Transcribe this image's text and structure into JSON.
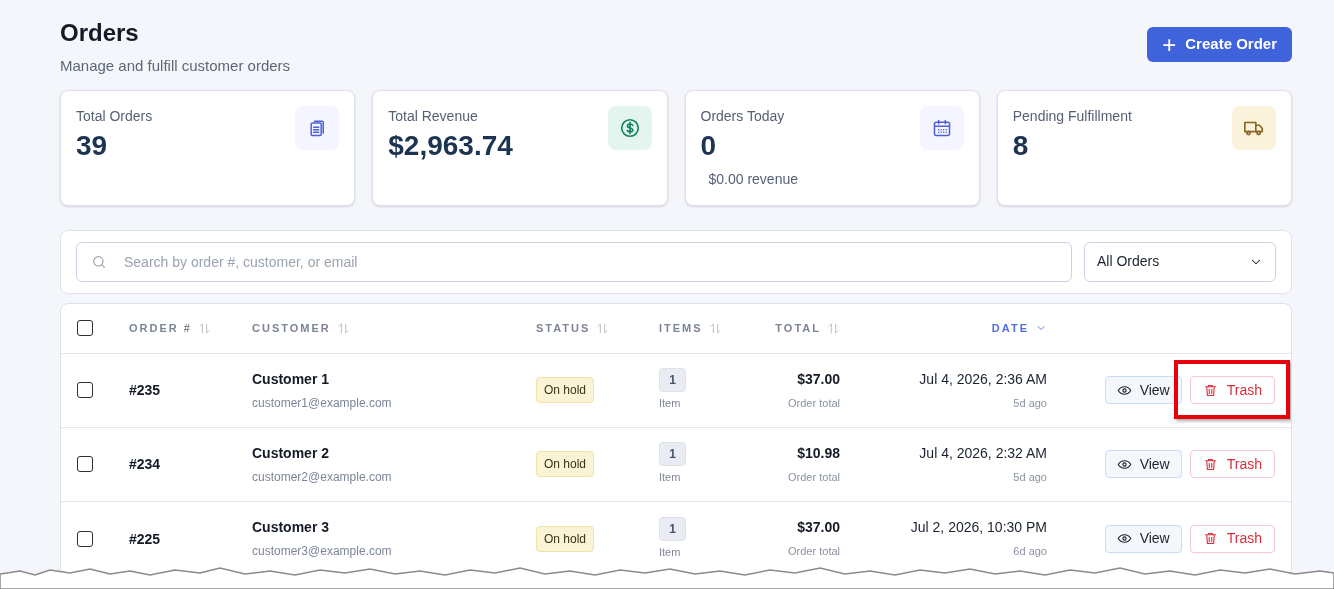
{
  "header": {
    "title": "Orders",
    "subtitle": "Manage and fulfill customer orders",
    "action": {
      "icon": "+",
      "label": "Create Order"
    }
  },
  "stats": [
    {
      "label": "Total Orders",
      "value": "39",
      "kind": "clipboard"
    },
    {
      "label": "Total Revenue",
      "value": "$2,963.74",
      "kind": "dollar"
    },
    {
      "label": "Orders Today",
      "value": "0",
      "note": "$0.00 revenue",
      "kind": "calendar"
    },
    {
      "label": "Pending Fulfillment",
      "value": "8",
      "kind": "truck"
    }
  ],
  "filters": {
    "search_placeholder": "Search by order #, customer, or email",
    "status_select": "All Orders"
  },
  "table": {
    "select_all_checked": false,
    "columns": [
      {
        "label": "ORDER #",
        "sorted": false
      },
      {
        "label": "CUSTOMER",
        "sorted": false
      },
      {
        "label": "STATUS",
        "sorted": false
      },
      {
        "label": "ITEMS",
        "sorted": false
      },
      {
        "label": "TOTAL",
        "sorted": false
      },
      {
        "label": "DATE",
        "sorted": true
      }
    ],
    "rows": [
      {
        "checked": false,
        "order": "#235",
        "customer": "Customer 1",
        "email": "customer1@example.com",
        "status": "On hold",
        "items": "1",
        "items_label": "Item",
        "total": "$37.00",
        "total_label": "Order total",
        "date": "Jul 4, 2026, 2:36 AM",
        "ago": "5d ago",
        "view": "View",
        "trash": "Trash",
        "trash_highlighted": true
      },
      {
        "checked": false,
        "order": "#234",
        "customer": "Customer 2",
        "email": "customer2@example.com",
        "status": "On hold",
        "items": "1",
        "items_label": "Item",
        "total": "$10.98",
        "total_label": "Order total",
        "date": "Jul 4, 2026, 2:32 AM",
        "ago": "5d ago",
        "view": "View",
        "trash": "Trash",
        "trash_highlighted": false
      },
      {
        "checked": false,
        "order": "#225",
        "customer": "Customer 3",
        "email": "customer3@example.com",
        "status": "On hold",
        "items": "1",
        "items_label": "Item",
        "total": "$37.00",
        "total_label": "Order total",
        "date": "Jul 2, 2026, 10:30 PM",
        "ago": "6d ago",
        "view": "View",
        "trash": "Trash",
        "trash_highlighted": false
      }
    ]
  }
}
